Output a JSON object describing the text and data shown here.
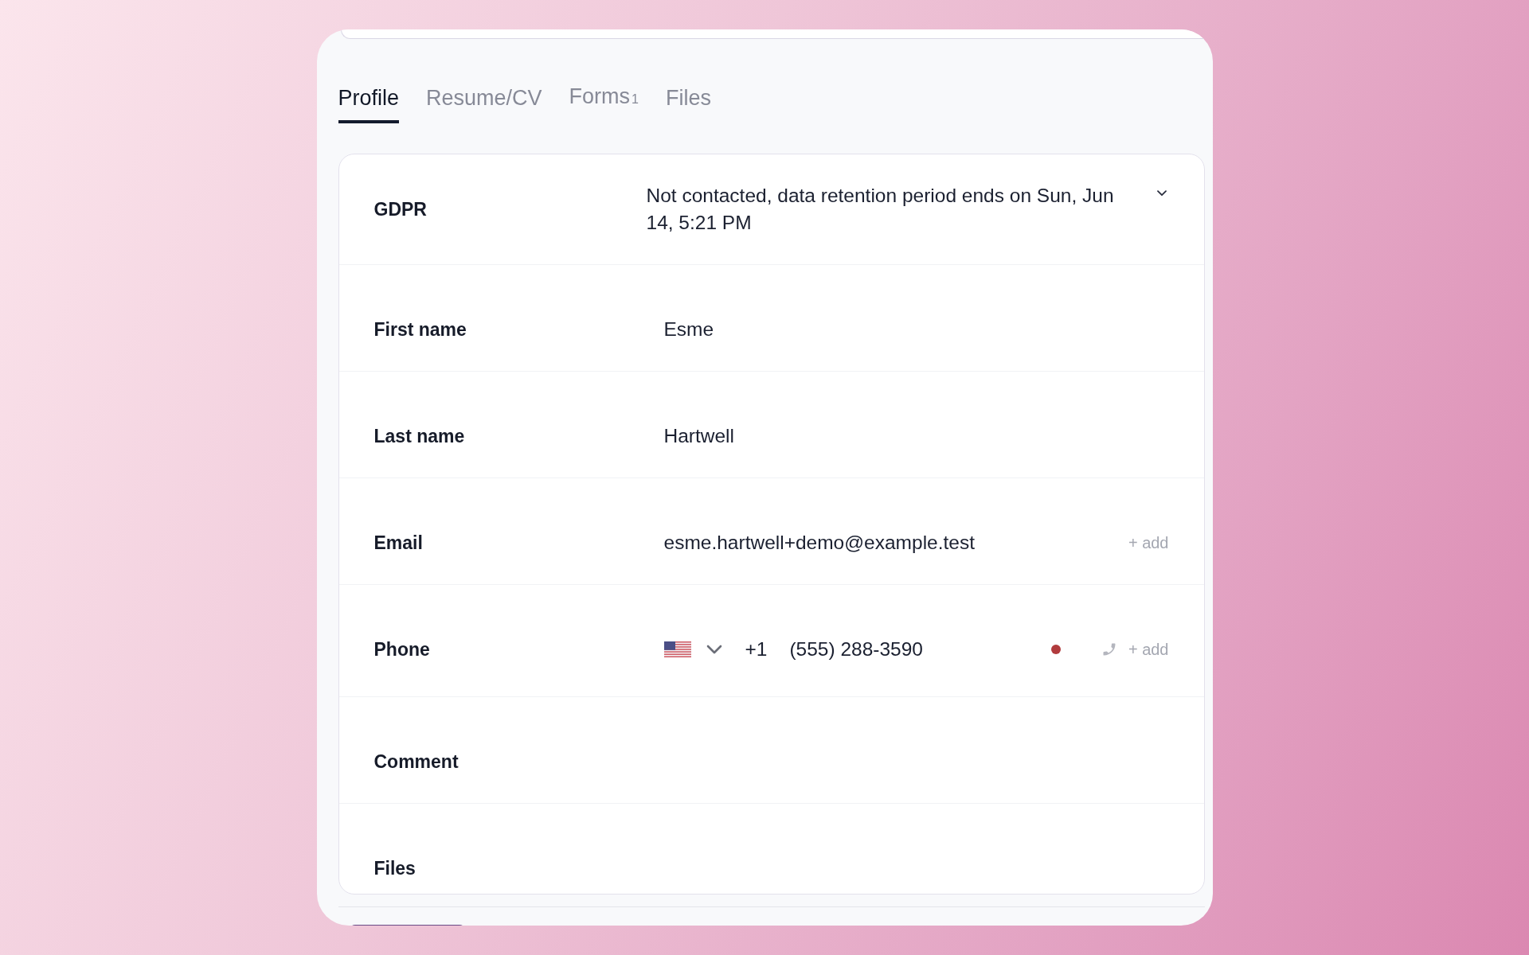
{
  "tabs": [
    {
      "label": "Profile",
      "selected": true
    },
    {
      "label": "Resume/CV",
      "selected": false
    },
    {
      "label": "Forms",
      "count": "1",
      "selected": false
    },
    {
      "label": "Files",
      "selected": false
    }
  ],
  "fields": [
    {
      "kind": "select",
      "label": "GDPR",
      "value": "Not contacted, data retention period ends on Sun, Jun 14, 5:21 PM"
    },
    {
      "kind": "text",
      "label": "First name",
      "value": "Esme"
    },
    {
      "kind": "text",
      "label": "Last name",
      "value": "Hartwell"
    },
    {
      "kind": "email",
      "label": "Email",
      "value": "esme.hartwell+demo@example.test",
      "add": "+ add"
    },
    {
      "kind": "phone",
      "label": "Phone",
      "country_code": "+1",
      "value": "(555) 288-3590",
      "add": "+ add"
    },
    {
      "kind": "text",
      "label": "Comment"
    },
    {
      "kind": "text",
      "label": "Files"
    }
  ]
}
